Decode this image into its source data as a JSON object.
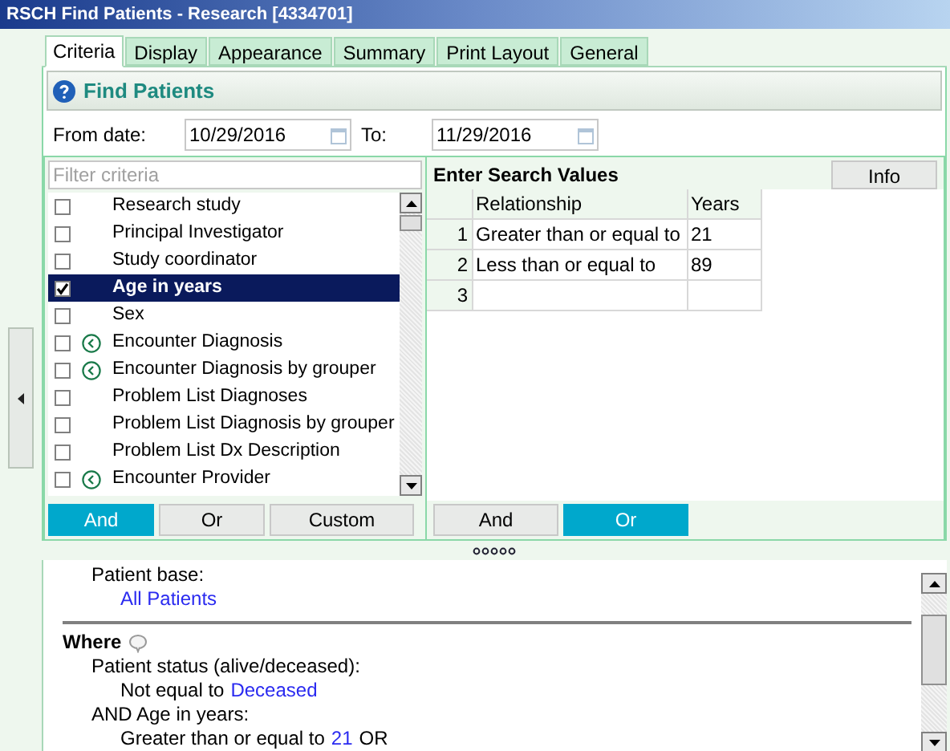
{
  "window": {
    "title": "RSCH Find Patients - Research [4334701]"
  },
  "tabs": [
    {
      "label": "Criteria",
      "selected": true
    },
    {
      "label": "Display",
      "selected": false
    },
    {
      "label": "Appearance",
      "selected": false
    },
    {
      "label": "Summary",
      "selected": false
    },
    {
      "label": "Print Layout",
      "selected": false
    },
    {
      "label": "General",
      "selected": false
    }
  ],
  "header": {
    "title": "Find Patients"
  },
  "dates": {
    "from_label": "From date:",
    "from_value": "10/29/2016",
    "to_label": "To:",
    "to_value": "11/29/2016"
  },
  "criteria": {
    "filter": {
      "placeholder": "Filter criteria"
    },
    "items": [
      {
        "label": "Research study",
        "checked": false,
        "selected": false,
        "has_icon": false
      },
      {
        "label": "Principal Investigator",
        "checked": false,
        "selected": false,
        "has_icon": false
      },
      {
        "label": "Study coordinator",
        "checked": false,
        "selected": false,
        "has_icon": false
      },
      {
        "label": "Age in years",
        "checked": true,
        "selected": true,
        "has_icon": false
      },
      {
        "label": "Sex",
        "checked": false,
        "selected": false,
        "has_icon": false
      },
      {
        "label": "Encounter Diagnosis",
        "checked": false,
        "selected": false,
        "has_icon": true
      },
      {
        "label": "Encounter Diagnosis by grouper",
        "checked": false,
        "selected": false,
        "has_icon": true
      },
      {
        "label": "Problem List Diagnoses",
        "checked": false,
        "selected": false,
        "has_icon": false
      },
      {
        "label": "Problem List Diagnosis by grouper",
        "checked": false,
        "selected": false,
        "has_icon": false
      },
      {
        "label": "Problem List Dx Description",
        "checked": false,
        "selected": false,
        "has_icon": false
      },
      {
        "label": "Encounter Provider",
        "checked": false,
        "selected": false,
        "has_icon": true
      }
    ],
    "buttons": [
      {
        "label": "And",
        "selected": true
      },
      {
        "label": "Or",
        "selected": false
      },
      {
        "label": "Custom",
        "selected": false
      }
    ]
  },
  "search_values": {
    "title": "Enter Search Values",
    "info_button": "Info",
    "columns": [
      "Relationship",
      "Years"
    ],
    "rows": [
      {
        "number": "1",
        "cells": [
          "Greater than or equal to",
          "21"
        ]
      },
      {
        "number": "2",
        "cells": [
          "Less than or equal to",
          "89"
        ]
      },
      {
        "number": "3",
        "cells": []
      }
    ],
    "buttons": [
      {
        "label": "And",
        "selected": false
      },
      {
        "label": "Or",
        "selected": true
      }
    ]
  },
  "summary": {
    "patient_base": {
      "label": "Patient base:",
      "value": "All Patients"
    },
    "where": {
      "heading": "Where",
      "criteria": [
        {
          "label": "Patient status (alive/deceased):",
          "conditions": [
            {
              "text": "Not equal to",
              "value": "Deceased"
            }
          ]
        },
        {
          "label": "AND Age in years:",
          "conditions": [
            {
              "text": "Greater than or equal to",
              "value": "21",
              "suffix": "OR"
            }
          ]
        }
      ]
    }
  }
}
